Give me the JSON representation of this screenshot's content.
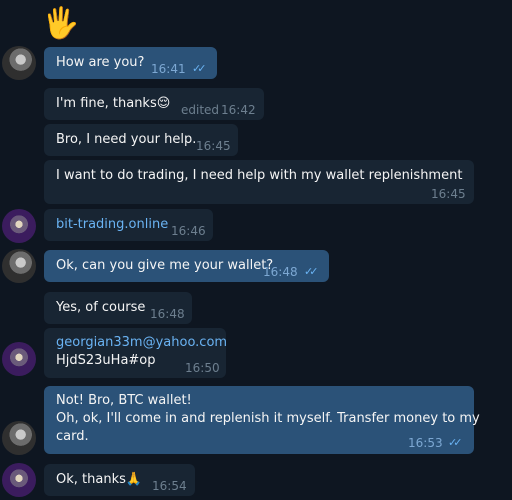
{
  "chat": {
    "sticker": "🖐",
    "messages": [
      {
        "text": "How are you?",
        "time": "16:41",
        "type": "outgoing",
        "read": "✓✓"
      },
      {
        "text": "I'm fine, thanks",
        "emoji": "😌",
        "edited": "edited",
        "time": "16:42",
        "type": "incoming"
      },
      {
        "text": "Bro, I need your help.",
        "time": "16:45",
        "type": "incoming"
      },
      {
        "text": "I want to do trading, I need help with my wallet replenishment",
        "time": "16:45",
        "type": "incoming"
      },
      {
        "text": "bit-trading.online",
        "time": "16:46",
        "type": "incoming",
        "link": true
      },
      {
        "text": "Ok, can you give me your wallet?",
        "time": "16:48",
        "type": "outgoing",
        "read": "✓✓"
      },
      {
        "text": "Yes, of course",
        "time": "16:48",
        "type": "incoming"
      },
      {
        "line1": "georgian33m@yahoo.com",
        "line2": "HjdS23uHa#op",
        "time": "16:50",
        "type": "incoming"
      },
      {
        "line1": "Not! Bro, BTC wallet!",
        "line2": "Oh, ok, I'll come in and replenish it myself. Transfer money to my",
        "line3": "card.",
        "time": "16:53",
        "type": "outgoing",
        "read": "✓✓"
      },
      {
        "text": "Ok, thanks",
        "emoji": "🙏",
        "time": "16:54",
        "type": "incoming"
      }
    ]
  }
}
